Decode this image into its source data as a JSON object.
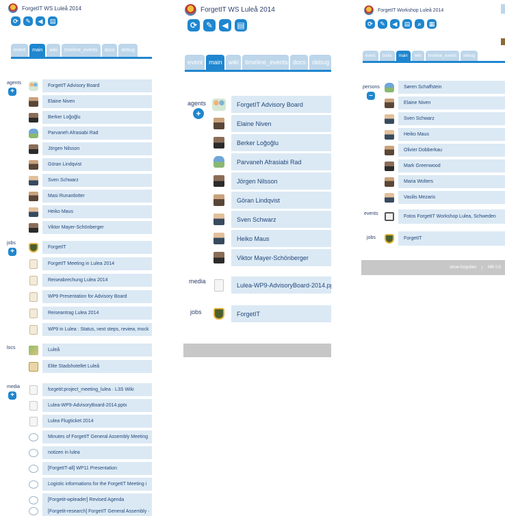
{
  "panel1": {
    "title": "ForgetIT WS Luleå 2014",
    "tabs": [
      "event",
      "main",
      "wiki",
      "timeline_events",
      "docs",
      "debug"
    ],
    "sections": {
      "agents": {
        "label": "agents",
        "items": [
          "ForgetIT Advisory Board",
          "Elaine Niven",
          "Berker Loğoğlu",
          "Parvaneh Afrasiabi Rad",
          "Jörgen Nilsson",
          "Göran Lindqvist",
          "Sven Schwarz",
          "Masi Runardotter",
          "Heiko Maus",
          "Viktor Mayer-Schönberger"
        ]
      },
      "jobs": {
        "label": "jobs",
        "items": [
          "ForgetIT",
          "ForgetIT Meeting in Lulea 2014",
          "Reiseabrechung Lulea 2014",
          "WP9 Presentation for Advisory Board",
          "Reiseantrag Lulea 2014",
          "WP9 in Lulea : Status, next steps, review, mock"
        ]
      },
      "locs": {
        "label": "locs",
        "items": [
          "Luleå",
          "Elite Stadshotellet Luleå"
        ]
      },
      "media": {
        "label": "media",
        "items": [
          "forgetit:project_meeting_lulea · L3S Wiki",
          "Lulea-WP9-AdvisoryBoard-2014.pptx",
          "Lulea Flugticket 2014",
          "Minutes of ForgetIT General Assembly Meeting",
          "notizen in lulea",
          "[ForgetIT-all] WP11 Presentation",
          "Logistic informations for the ForgetIT Meeting i",
          "[Forgetit-wpleader] Revised Agenda",
          "[Forgetit-research] ForgetIT General Assembly ·"
        ]
      }
    }
  },
  "panel2": {
    "title": "ForgetIT WS Luleå 2014",
    "tabs": [
      "event",
      "main",
      "wiki",
      "timeline_events",
      "docs",
      "debug"
    ],
    "sections": {
      "agents": {
        "label": "agents",
        "items": [
          "ForgetIT Advisory Board",
          "Elaine Niven",
          "Berker Loğoğlu",
          "Parvaneh Afrasiabi Rad",
          "Jörgen Nilsson",
          "Göran Lindqvist",
          "Sven Schwarz",
          "Heiko Maus",
          "Viktor Mayer-Schönberger"
        ]
      },
      "media": {
        "label": "media",
        "items": [
          "Lulea-WP9-AdvisoryBoard-2014.pptx"
        ]
      },
      "jobs": {
        "label": "jobs",
        "items": [
          "ForgetIT"
        ]
      }
    }
  },
  "panel3": {
    "title": "ForgetIT Workshop Luleå 2014",
    "tabs": [
      "event",
      "tasks",
      "main",
      "wiki",
      "timeline_events",
      "debug"
    ],
    "sections": {
      "persons": {
        "label": "persons",
        "items": [
          "Søren Schaffstein",
          "Elaine Niven",
          "Sven Schwarz",
          "Heiko Maus",
          "Olivier Dobberkau",
          "Mark Greenwood",
          "Maria Wolters",
          "Vasilis Mezaris"
        ]
      },
      "events": {
        "label": "events",
        "items": [
          "Fotos ForgetIT Workshop Lulea, Schweden"
        ]
      },
      "jobs": {
        "label": "jobs",
        "items": [
          "ForgetIT"
        ]
      }
    },
    "footer": {
      "show_forgotten": "show forgotten",
      "mb": "MB 0.5"
    }
  }
}
